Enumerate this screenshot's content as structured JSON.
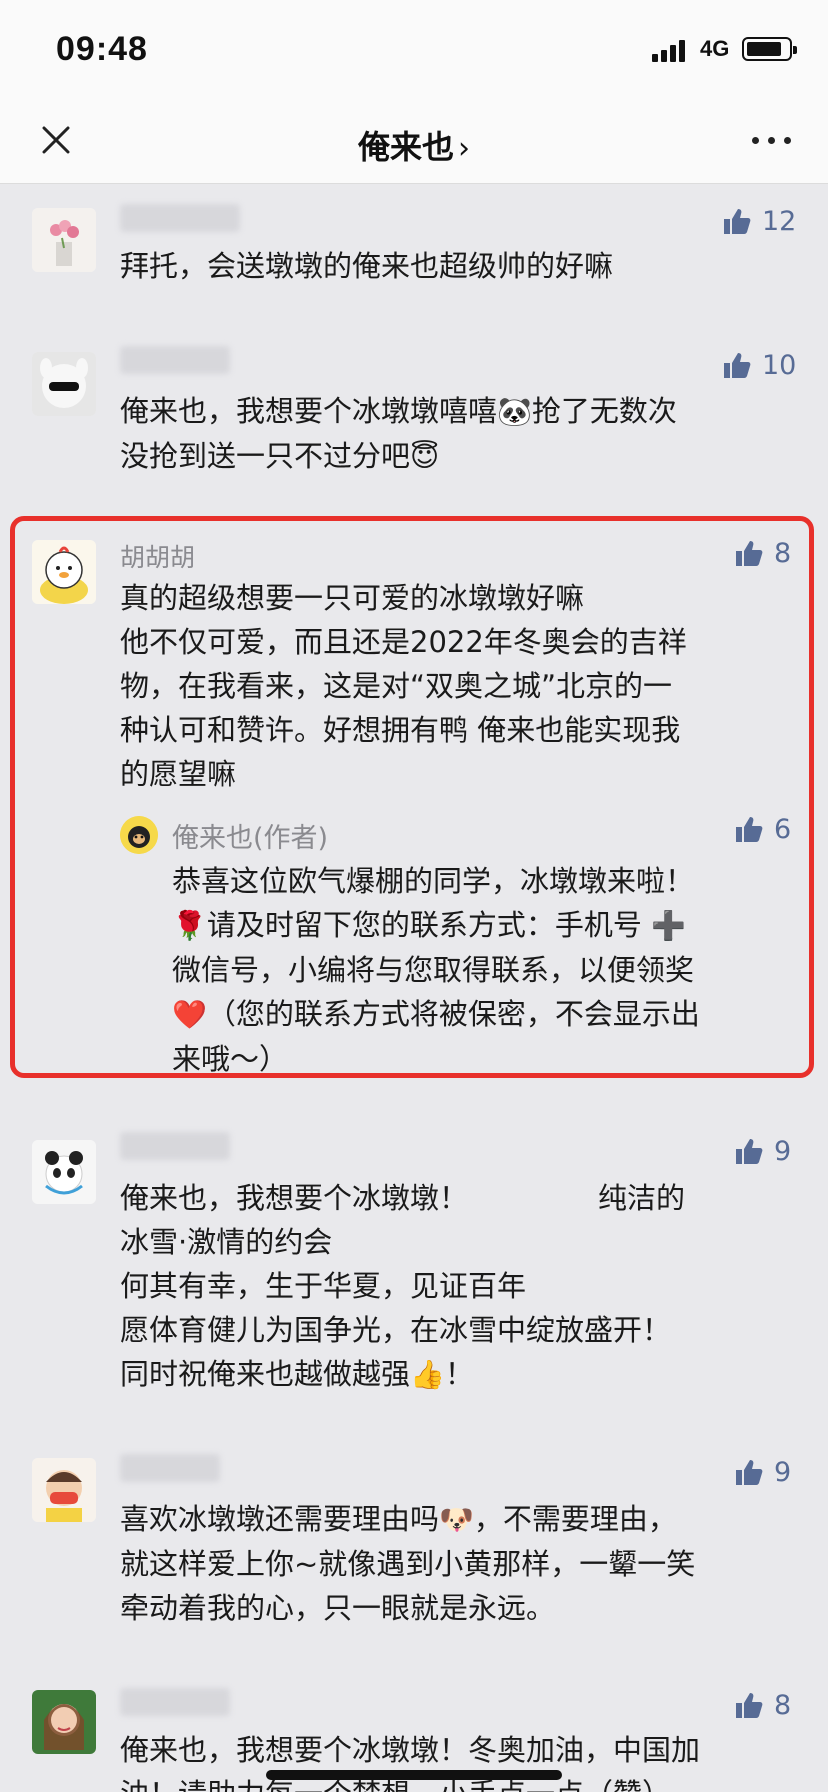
{
  "status_bar": {
    "time": "09:48",
    "network": "4G"
  },
  "nav": {
    "title": "俺来也",
    "chevron": "›"
  },
  "comments": [
    {
      "nickname": "",
      "likes": "12",
      "text": "拜托，会送墩墩的俺来也超级帅的好嘛"
    },
    {
      "nickname": "",
      "likes": "10",
      "text_a": "俺来也，我想要个冰墩墩嘻嘻",
      "emoji_panda": "🐼",
      "text_b": "抢了无数次",
      "text_c": "没抢到送一只不过分吧",
      "emoji_halo": "😇"
    },
    {
      "nickname": "胡胡胡",
      "likes": "8",
      "text": "真的超级想要一只可爱的冰墩墩好嘛\n他不仅可爱，而且还是2022年冬奥会的吉祥\n物，在我看来，这是对“双奥之城”北京的一\n种认可和赞许。好想拥有鸭 俺来也能实现我\n的愿望嘛",
      "reply": {
        "nickname": "俺来也(作者)",
        "likes": "6",
        "line1": "恭喜这位欧气爆棚的同学，冰墩墩来啦！",
        "rose": "🌹",
        "line2": "请及时留下您的联系方式：手机号",
        "plus": "➕",
        "line3": "微信号，小编将与您取得联系，以便领奖",
        "heart": "❤️",
        "line4": "（您的联系方式将被保密，不会显示出",
        "line5": "来哦～）"
      }
    },
    {
      "nickname": "",
      "likes": "9",
      "text_a": "俺来也，我想要个冰墩墩！",
      "text_b": "纯洁的",
      "text_c": "冰雪·激情的约会\n何其有幸，生于华夏，见证百年\n愿体育健儿为国争光，在冰雪中绽放盛开！",
      "text_d": "同时祝俺来也越做越强",
      "emoji_thumb": "👍",
      "text_e": "！"
    },
    {
      "nickname": "",
      "likes": "9",
      "text_a": "喜欢冰墩墩还需要理由吗",
      "emoji_dog": "🐶",
      "text_b": "，不需要理由，",
      "text_c": "就这样爱上你~就像遇到小黄那样，一颦一笑\n牵动着我的心，只一眼就是永远。"
    },
    {
      "nickname": "",
      "likes": "8",
      "text": "俺来也，我想要个冰墩墩！冬奥加油，中国加",
      "text_more": "油！请助力每一个梦想，小手点一点（赞）"
    }
  ]
}
